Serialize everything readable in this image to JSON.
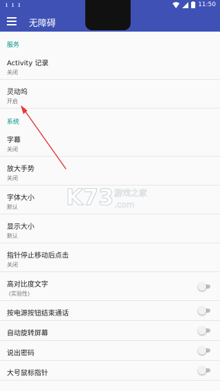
{
  "status_bar": {
    "time": "11:50",
    "download_icon": "download-icon",
    "wifi_icon": "wifi-icon",
    "signal_icon": "signal-icon",
    "battery_icon": "battery-icon"
  },
  "app_bar": {
    "title": "无障碍",
    "menu_icon": "menu-icon",
    "color": "#3f51b5"
  },
  "sections": {
    "services": "服务",
    "system": "系统"
  },
  "items": {
    "activity": {
      "title": "Activity 记录",
      "summary": "关闭"
    },
    "flexible": {
      "title": "灵动坞",
      "summary": "开启"
    },
    "captions": {
      "title": "字幕",
      "summary": "关闭"
    },
    "magnify": {
      "title": "放大手势",
      "summary": "关闭"
    },
    "font_size": {
      "title": "字体大小",
      "summary": "默认"
    },
    "display_size": {
      "title": "显示大小",
      "summary": "默认"
    },
    "dwell_click": {
      "title": "指针停止移动后点击",
      "summary": "关闭"
    },
    "high_contrast": {
      "title": "高对比度文字",
      "summary": "(实验性)",
      "checked": false
    },
    "power_end_call": {
      "title": "按电源按钮结束通话",
      "checked": false
    },
    "auto_rotate": {
      "title": "自动旋转屏幕",
      "checked": false
    },
    "speak_password": {
      "title": "说出密码",
      "checked": false
    },
    "large_pointer": {
      "title": "大号鼠标指针",
      "checked": false
    }
  },
  "accent_color": "#009688",
  "annotation_color": "#e53935",
  "watermark": {
    "logo_text": "K73",
    "site_text": "游戏之家",
    "domain_text": ".com"
  }
}
